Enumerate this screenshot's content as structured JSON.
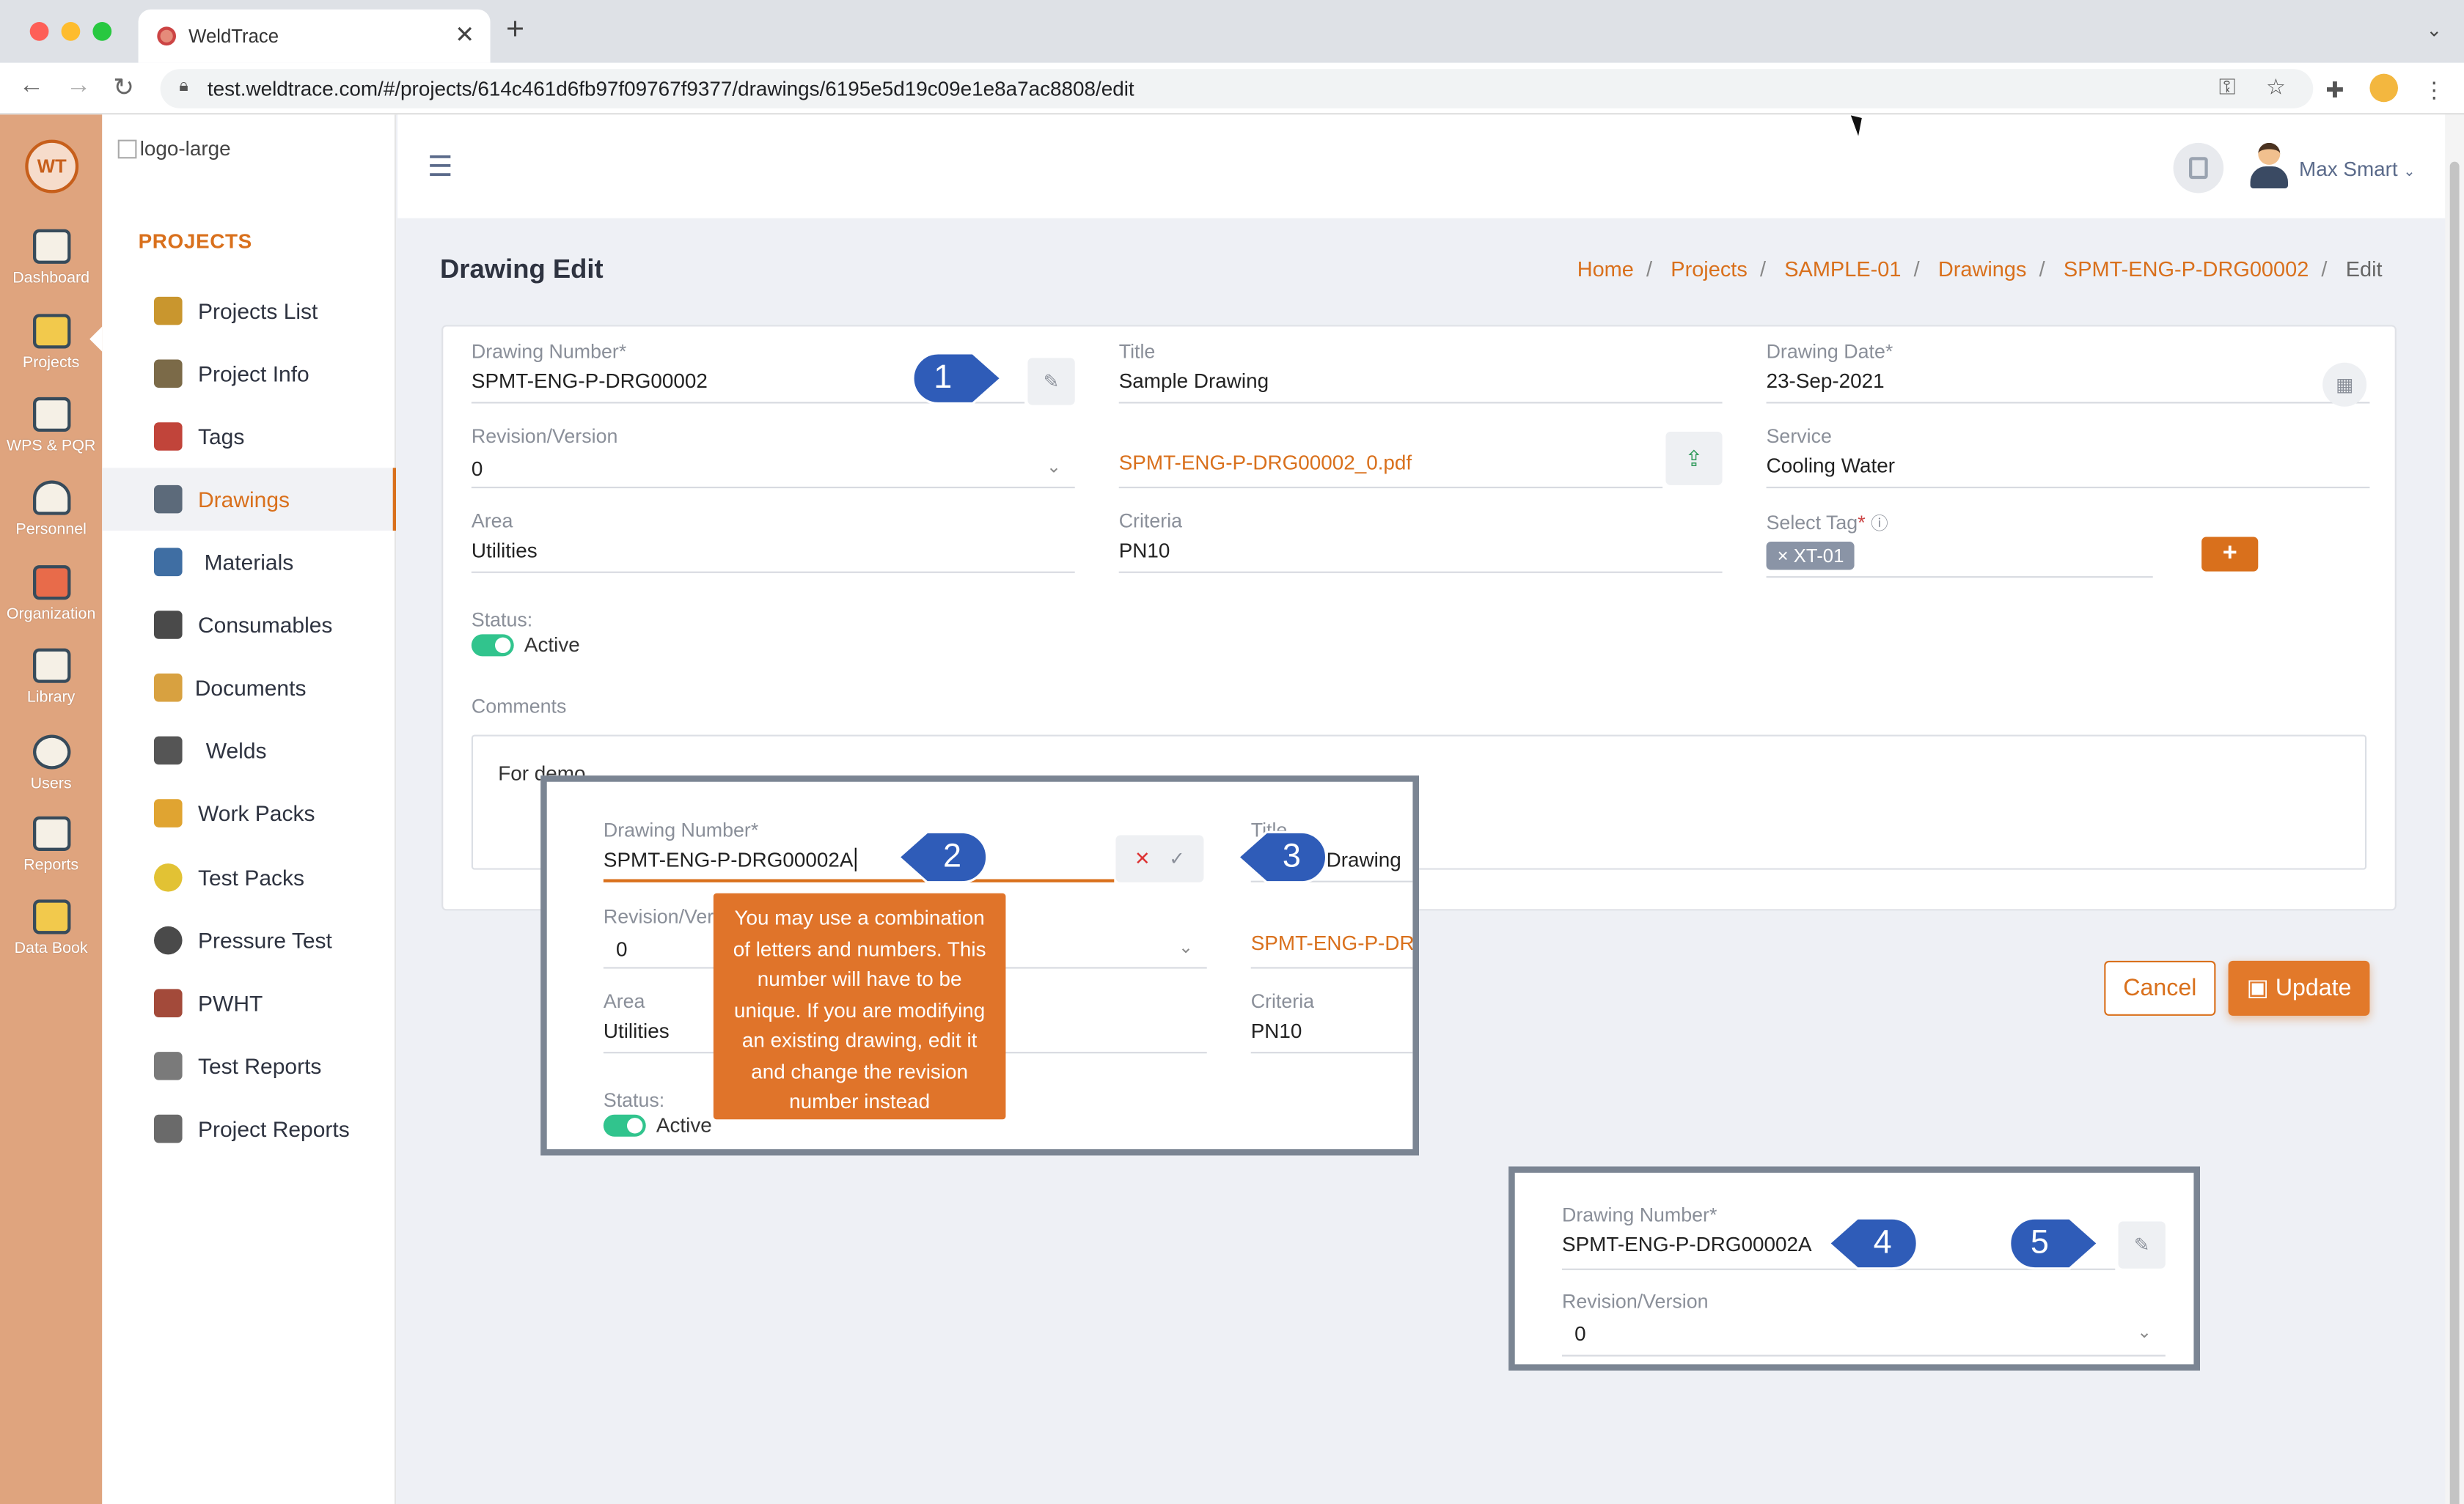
{
  "browser": {
    "tab_title": "WeldTrace",
    "url": "test.weldtrace.com/#/projects/614c461d6fb97f09767f9377/drawings/6195e5d19c09e1e8a7ac8808/edit"
  },
  "iconbar": {
    "logo_text": "WT",
    "items": [
      {
        "label": "Dashboard"
      },
      {
        "label": "Projects"
      },
      {
        "label": "WPS & PQR"
      },
      {
        "label": "Personnel"
      },
      {
        "label": "Organization"
      },
      {
        "label": "Library"
      },
      {
        "label": "Users"
      },
      {
        "label": "Reports"
      },
      {
        "label": "Data Book"
      }
    ]
  },
  "sidebar": {
    "logo_alt": "logo-large",
    "heading": "PROJECTS",
    "items": [
      {
        "label": "Projects List",
        "color": "#c9962e"
      },
      {
        "label": "Project Info",
        "color": "#7b6a48"
      },
      {
        "label": "Tags",
        "color": "#c1443a"
      },
      {
        "label": "Drawings",
        "color": "#5c6a7a"
      },
      {
        "label": "Materials",
        "color": "#3f6ea3"
      },
      {
        "label": "Consumables",
        "color": "#4a4a4a"
      },
      {
        "label": "Documents",
        "color": "#d8a140"
      },
      {
        "label": "Welds",
        "color": "#555555"
      },
      {
        "label": "Work Packs",
        "color": "#e0a431"
      },
      {
        "label": "Test Packs",
        "color": "#e2c234"
      },
      {
        "label": "Pressure Test",
        "color": "#4a4a4a"
      },
      {
        "label": "PWHT",
        "color": "#a34a3a"
      },
      {
        "label": "Test Reports",
        "color": "#7a7a7a"
      },
      {
        "label": "Project Reports",
        "color": "#6a6a6a"
      }
    ]
  },
  "header": {
    "user_name": "Max Smart"
  },
  "page": {
    "title": "Drawing Edit",
    "breadcrumb": [
      "Home",
      "Projects",
      "SAMPLE-01",
      "Drawings",
      "SPMT-ENG-P-DRG00002",
      "Edit"
    ]
  },
  "form": {
    "drawing_number_label": "Drawing Number",
    "drawing_number": "SPMT-ENG-P-DRG00002",
    "title_label": "Title",
    "title": "Sample Drawing",
    "drawing_date_label": "Drawing Date",
    "drawing_date": "23-Sep-2021",
    "revision_label": "Revision/Version",
    "revision": "0",
    "file_name": "SPMT-ENG-P-DRG00002_0.pdf",
    "service_label": "Service",
    "service": "Cooling Water",
    "area_label": "Area",
    "area": "Utilities",
    "criteria_label": "Criteria",
    "criteria": "PN10",
    "select_tag_label": "Select Tag",
    "tag": "XT-01",
    "status_label": "Status:",
    "status": "Active",
    "comments_label": "Comments",
    "comments": "For demo",
    "required_mark": "*"
  },
  "actions": {
    "cancel": "Cancel",
    "update": "Update"
  },
  "overlay1": {
    "drawing_number_label": "Drawing Number",
    "drawing_number": "SPMT-ENG-P-DRG00002A",
    "title_label": "Title",
    "title_partial": "Drawing",
    "revision_label": "Revision/Ver",
    "revision": "0",
    "file_partial": "SPMT-ENG-P-DRC",
    "area_label": "Area",
    "area": "Utilities",
    "criteria_label": "Criteria",
    "criteria": "PN10",
    "status_label": "Status:",
    "status": "Active",
    "tooltip": "You may use a combination of letters and numbers. This number will have to be unique. If you are modifying an existing drawing, edit it and change the revision number instead"
  },
  "overlay2": {
    "drawing_number_label": "Drawing Number",
    "drawing_number": "SPMT-ENG-P-DRG00002A",
    "revision_label": "Revision/Version",
    "revision": "0"
  },
  "callouts": [
    "1",
    "2",
    "3",
    "4",
    "5"
  ],
  "colors": {
    "accent": "#d9701c",
    "callout": "#2f5cb8",
    "iconbar": "#dfa47e",
    "toggle_on": "#31c48d"
  }
}
